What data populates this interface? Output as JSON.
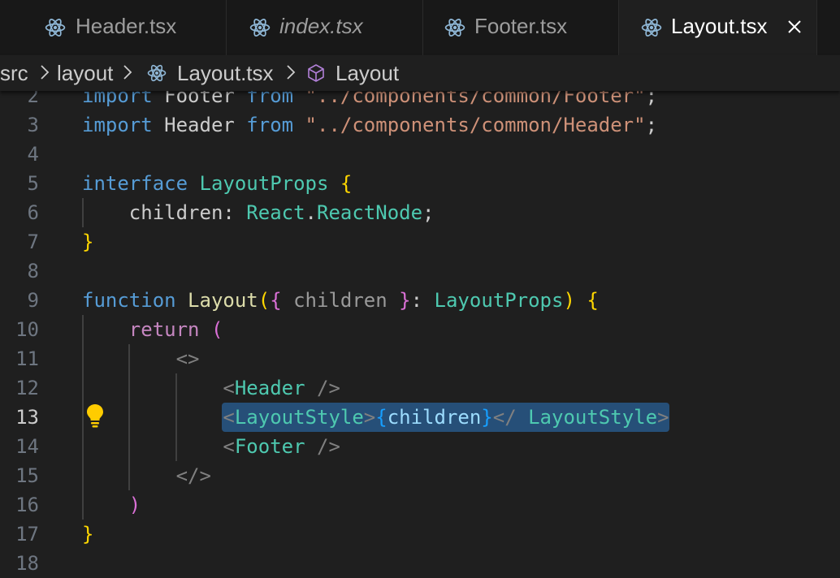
{
  "tabs": [
    {
      "label": "Header.tsx",
      "icon": "react-icon"
    },
    {
      "label": "index.tsx",
      "icon": "react-icon"
    },
    {
      "label": "Footer.tsx",
      "icon": "react-icon"
    },
    {
      "label": "Layout.tsx",
      "icon": "react-icon",
      "active": true,
      "close_icon": "close-icon"
    }
  ],
  "breadcrumb": {
    "items": [
      "src",
      "layout",
      "Layout.tsx",
      "Layout"
    ],
    "separator_icon": "chevron-right-icon",
    "file_icon": "react-icon",
    "symbol_icon": "cube-icon"
  },
  "editor": {
    "lines": [
      {
        "number": "2",
        "text": "import Footer from \"../components/common/Footer\";"
      },
      {
        "number": "3",
        "text": "import Header from \"../components/common/Header\";"
      },
      {
        "number": "4",
        "text": ""
      },
      {
        "number": "5",
        "text": "interface LayoutProps {"
      },
      {
        "number": "6",
        "text": "    children: React.ReactNode;"
      },
      {
        "number": "7",
        "text": "}"
      },
      {
        "number": "8",
        "text": ""
      },
      {
        "number": "9",
        "text": "function Layout({ children }: LayoutProps) {"
      },
      {
        "number": "10",
        "text": "    return ("
      },
      {
        "number": "11",
        "text": "        <>"
      },
      {
        "number": "12",
        "text": "            <Header />"
      },
      {
        "number": "13",
        "text": "            <LayoutStyle>{children}</ LayoutStyle>"
      },
      {
        "number": "14",
        "text": "            <Footer />"
      },
      {
        "number": "15",
        "text": "        </>"
      },
      {
        "number": "16",
        "text": "    )"
      },
      {
        "number": "17",
        "text": "}"
      },
      {
        "number": "18",
        "text": ""
      }
    ],
    "active_line": "13",
    "lightbulb_icon": "lightbulb-icon"
  },
  "colors": {
    "tabbar_bg": "#181818",
    "editor_bg": "#1f1f1f",
    "keyword": "#569cd6",
    "control": "#c586c0",
    "string": "#ce9178",
    "type": "#4ec9b0",
    "function": "#dcdcaa",
    "variable": "#9cdcfe",
    "selection": "#264f78",
    "lightbulb": "#ffcc00"
  }
}
